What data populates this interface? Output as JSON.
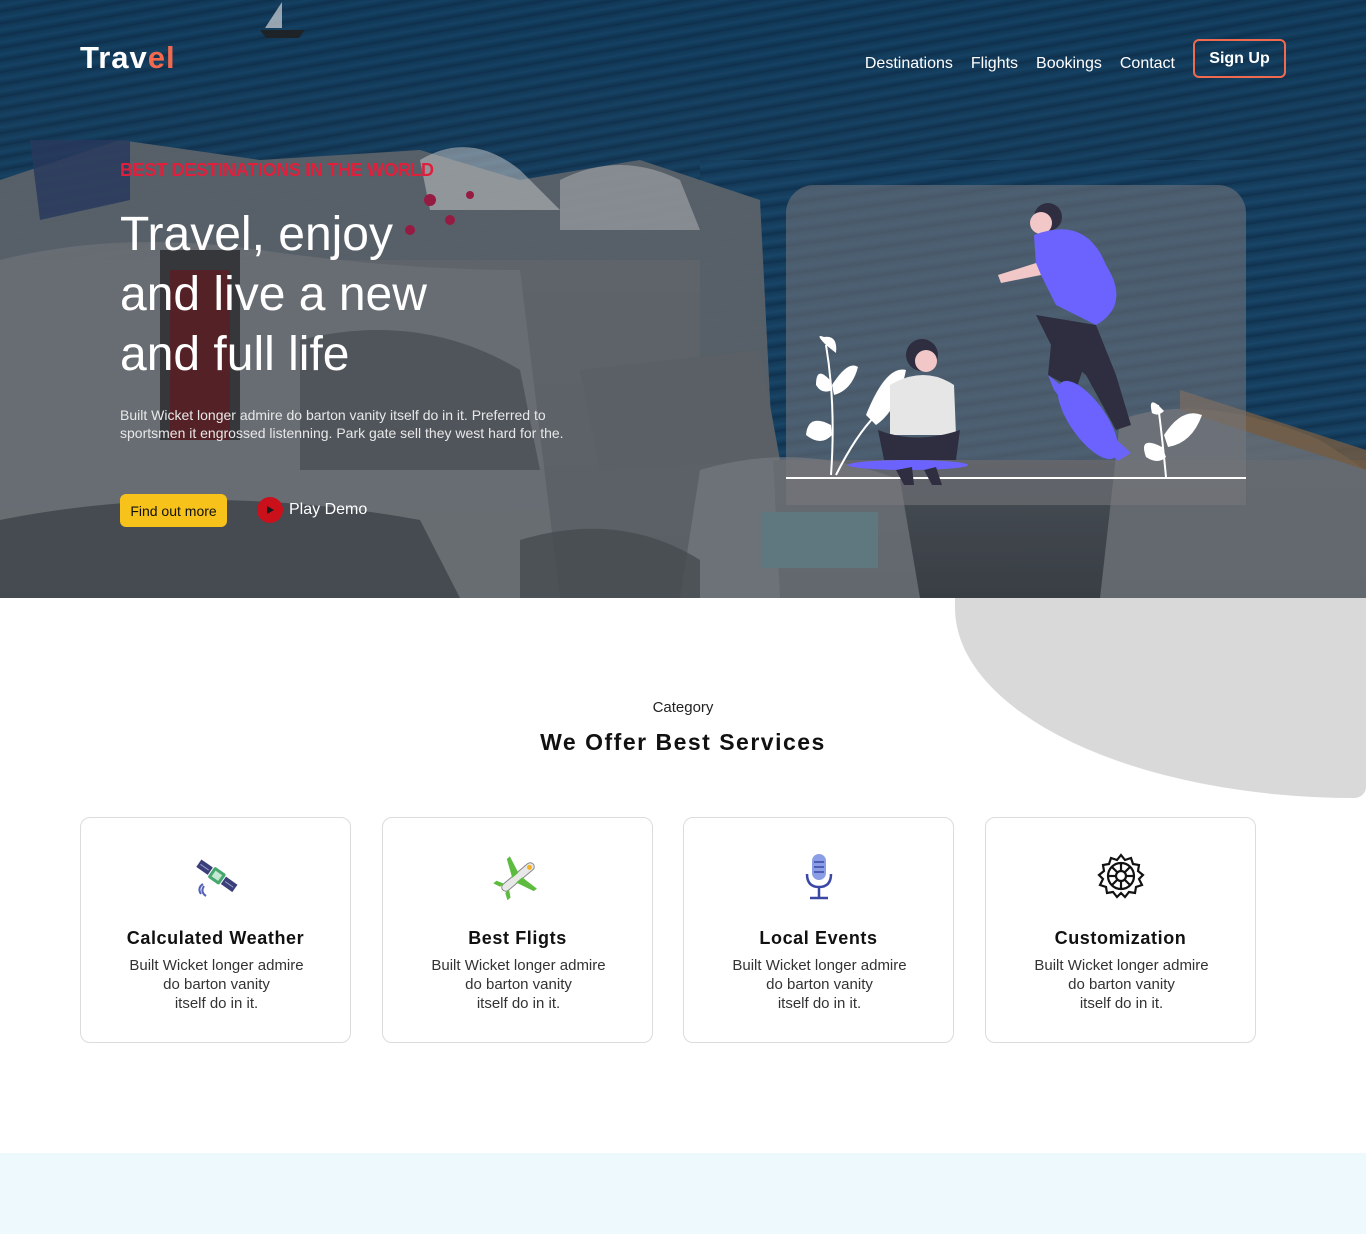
{
  "brand": {
    "prefix": "Trav",
    "suffix": "el",
    "accent_color": "#f2694e"
  },
  "nav": {
    "links": [
      "Destinations",
      "Flights",
      "Bookings",
      "Contact"
    ],
    "signup": "Sign Up"
  },
  "hero": {
    "eyebrow": "BEST DESTINATIONS IN THE WORLD",
    "headline": [
      "Travel, enjoy",
      "and live a new",
      "and full life"
    ],
    "description": "Built Wicket longer admire do barton vanity itself do in it. Preferred to sportsmen it engrossed listenning. Park gate sell they west hard for the.",
    "cta_primary": "Find out more",
    "cta_secondary": "Play Demo",
    "eyebrow_color": "#e01f3d",
    "cta_color": "#f7c21a"
  },
  "services": {
    "category": "Category",
    "title": "We Offer Best Services",
    "cards": [
      {
        "title": "Calculated Weather",
        "lines": [
          "Built Wicket longer admire",
          "do barton vanity",
          "itself do in it."
        ],
        "icon": "satellite-icon"
      },
      {
        "title": "Best Fligts",
        "lines": [
          "Built Wicket longer admire",
          "do barton vanity",
          "itself do in it."
        ],
        "icon": "airplane-icon"
      },
      {
        "title": "Local Events",
        "lines": [
          "Built Wicket longer admire",
          "do barton vanity",
          "itself do in it."
        ],
        "icon": "microphone-icon"
      },
      {
        "title": "Customization",
        "lines": [
          "Built Wicket longer admire",
          "do barton vanity",
          "itself do in it."
        ],
        "icon": "gear-icon"
      }
    ]
  }
}
